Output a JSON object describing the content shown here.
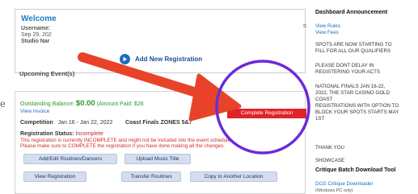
{
  "welcome": {
    "title": "Welcome",
    "username_label": "Username:",
    "date_text": "Sep 29, 202",
    "studio_label": "Studio Nar",
    "side_colon": "s:"
  },
  "actions": {
    "add_new_registration": "Add New Registration"
  },
  "upcoming": {
    "title": "Upcoming Event(s)"
  },
  "card": {
    "side_letter": "e",
    "balance_label": "Outstanding Balance:",
    "balance_amount": "$0.00",
    "amount_paid": "(Amount Paid: $26",
    "view_invoice": "View Invoice",
    "complete_button": "Complete Registration",
    "competition_label": "Competition",
    "competition_dates": "Jan 16 - Jan 22, 2022",
    "competition_name": "Coast Finals ZONES 5&7",
    "status_label": "Registration Status:",
    "status_value": "Incomplete",
    "warning_line1": "This registration is currently INCOMPLETE and might not be included into the event schedule.",
    "warning_line2": "Please make sure to COMPLETE the registration if you have done making all the changes.",
    "buttons": {
      "add_edit": "Add/Edit Routines/Dancers",
      "upload_music": "Upload Music Title",
      "view_registration": "View Registration",
      "transfer_routines": "Transfer Routines",
      "copy_location": "Copy to Another Location"
    }
  },
  "sidebar": {
    "dashboard_announcement": "Dashboard Announcement",
    "view_rules": "View Rules",
    "view_fees": "View Fees",
    "spots_line1": "SPOTS ARE NOW STARTING TO",
    "spots_line2": "FILL FOR ALL OUR QUALIFIERS",
    "delay_line1": "PLEASE DONT DELAY IN",
    "delay_line2": "REGISTERING YOUR ACTS",
    "finals_line1": "NATIONAL FINALS JAN 16-22,",
    "finals_line2": "2022, THE STAR CASINO GOLD",
    "finals_line3": "COAST",
    "finals_line4": "REGISTRATIONS WITH OPTION TO",
    "finals_line5": "BLOCK YOUR SPOTS STARTS MAY",
    "finals_line6": "1ST",
    "thank_you": "THANK YOU",
    "showcase": "SHOWCASE",
    "critique_title": "Critique Batch Download Tool",
    "dcg_link": "DCG Critique Downloader",
    "windows_note": "(Windows PC only)"
  },
  "colors": {
    "accent_blue": "#1a7fc4",
    "complete_red": "#e0232a",
    "annotation_red": "#e8432a",
    "annotation_purple": "#6a2bd9",
    "balance_green": "#2c9a2c"
  }
}
